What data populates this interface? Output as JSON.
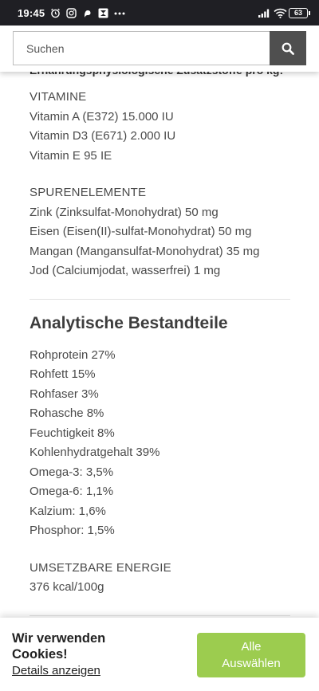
{
  "status_bar": {
    "time": "19:45",
    "battery": "63",
    "icons": [
      "alarm-icon",
      "instagram-icon",
      "app-notification-icon",
      "app-notification-icon",
      "more-dots-icon",
      "signal-icon",
      "wifi-icon",
      "battery-icon"
    ]
  },
  "search": {
    "placeholder": "Suchen"
  },
  "content": {
    "cut_heading": "Ernährungsphysiologische Zusatzstoffe pro kg:",
    "vitamine": {
      "heading": "VITAMINE",
      "items": [
        "Vitamin A (E372) 15.000 IU",
        "Vitamin D3 (E671) 2.000 IU",
        "Vitamin E 95 IE"
      ]
    },
    "spurenelemente": {
      "heading": "SPURENELEMENTE",
      "items": [
        "Zink (Zinksulfat-Monohydrat) 50 mg",
        "Eisen (Eisen(II)-sulfat-Monohydrat) 50 mg",
        "Mangan (Mangansulfat-Monohydrat) 35 mg",
        "Jod (Calciumjodat, wasserfrei) 1 mg"
      ]
    },
    "analytische": {
      "title": "Analytische Bestandteile",
      "items": [
        "Rohprotein 27%",
        "Rohfett 15%",
        "Rohfaser 3%",
        "Rohasche 8%",
        "Feuchtigkeit 8%",
        "Kohlenhydratgehalt 39%",
        "Omega-3: 3,5%",
        "Omega-6: 1,1%",
        "Kalzium: 1,6%",
        "Phosphor: 1,5%"
      ]
    },
    "energie": {
      "heading": "UMSETZBARE ENERGIE",
      "value": "376 kcal/100g"
    }
  },
  "cookie": {
    "title": "Wir verwenden Cookies!",
    "details_link": "Details anzeigen",
    "accept_line1": "Alle",
    "accept_line2": "Auswählen",
    "accent_color": "#9ccc4f"
  }
}
